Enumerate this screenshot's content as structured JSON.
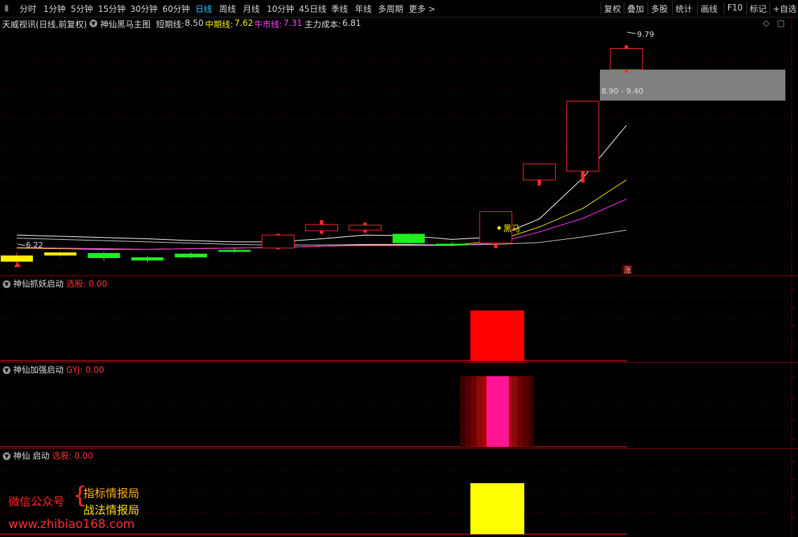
{
  "toolbar": {
    "periods": [
      "分时",
      "1分钟",
      "5分钟",
      "15分钟",
      "30分钟",
      "60分钟",
      "日线",
      "周线",
      "月线",
      "10分钟",
      "45日线",
      "季线",
      "年线",
      "多周期",
      "更多 >"
    ],
    "active_period": "日线",
    "right_buttons": [
      "复权",
      "叠加",
      "多股",
      "统计",
      "画线",
      "F10",
      "标记",
      "+自选"
    ]
  },
  "legend": {
    "stock": "天威视讯(日线,前复权)",
    "indicator": "神仙黑马主图",
    "short_label": "短期线:",
    "short_value": "8.50",
    "mid_label": "中期线:",
    "mid_value": "7.62",
    "bull_label": "牛市线:",
    "bull_value": "7.31",
    "cost_label": "主力成本:",
    "cost_value": "6.81",
    "right_icons": [
      "diamond-icon",
      "expand-icon"
    ]
  },
  "main_chart": {
    "high_label": "9.79",
    "low_label": "6.22",
    "range_label": "8.90 - 9.40",
    "signal_label": "黑马",
    "rise_badge": "涨"
  },
  "panels": [
    {
      "title": "神仙抓妖启动",
      "field_label": "选股:",
      "field_value": "0.00",
      "field_color": "#ff3333"
    },
    {
      "title": "神仙加强启动",
      "field_label": "GYJ:",
      "field_value": "0.00",
      "field_color": "#ff3333"
    },
    {
      "title": "神仙 启动",
      "field_label": "选股:",
      "field_value": "0.00",
      "field_color": "#ff3333"
    }
  ],
  "watermark": {
    "prefix": "微信公众号",
    "line1": "指标情报局",
    "line2": "战法情报局",
    "url": "www.zhibiao168.com"
  },
  "colors": {
    "up": "#ff2a2a",
    "down": "#22ee22",
    "flat": "#ffee00",
    "short_line": "#ffffff",
    "mid_line": "#ffee00",
    "bull_line": "#ff33ff",
    "cost_line": "#cccccc",
    "active_period": "#2fc4ff"
  },
  "chart_data": {
    "type": "candlestick",
    "candles": [
      {
        "o": 6.3,
        "c": 6.4,
        "h": 6.45,
        "l": 6.22,
        "color": "flat"
      },
      {
        "o": 6.4,
        "c": 6.45,
        "h": 6.47,
        "l": 6.38,
        "color": "flat"
      },
      {
        "o": 6.44,
        "c": 6.36,
        "h": 6.46,
        "l": 6.32,
        "color": "down"
      },
      {
        "o": 6.37,
        "c": 6.32,
        "h": 6.39,
        "l": 6.28,
        "color": "down"
      },
      {
        "o": 6.43,
        "c": 6.37,
        "h": 6.45,
        "l": 6.35,
        "color": "down"
      },
      {
        "o": 6.49,
        "c": 6.46,
        "h": 6.51,
        "l": 6.44,
        "color": "down"
      },
      {
        "o": 6.52,
        "c": 6.73,
        "h": 6.75,
        "l": 6.5,
        "color": "up"
      },
      {
        "o": 6.8,
        "c": 6.9,
        "h": 6.97,
        "l": 6.75,
        "color": "up"
      },
      {
        "o": 6.81,
        "c": 6.89,
        "h": 6.93,
        "l": 6.77,
        "color": "up"
      },
      {
        "o": 6.75,
        "c": 6.6,
        "h": 6.76,
        "l": 6.6,
        "color": "down"
      },
      {
        "o": 6.59,
        "c": 6.57,
        "h": 6.62,
        "l": 6.56,
        "color": "down"
      },
      {
        "o": 6.6,
        "c": 7.11,
        "h": 7.11,
        "l": 6.52,
        "color": "up"
      },
      {
        "o": 7.62,
        "c": 7.88,
        "h": 7.88,
        "l": 7.53,
        "color": "up"
      },
      {
        "o": 7.76,
        "c": 8.89,
        "h": 8.89,
        "l": 7.58,
        "color": "up"
      },
      {
        "o": 9.4,
        "c": 9.74,
        "h": 9.79,
        "l": 9.35,
        "color": "up"
      }
    ],
    "series": [
      {
        "name": "短期线",
        "color": "short_line",
        "values": [
          6.73,
          6.71,
          6.69,
          6.67,
          6.64,
          6.62,
          6.62,
          6.67,
          6.73,
          6.72,
          6.66,
          6.7,
          6.99,
          7.65,
          8.5
        ]
      },
      {
        "name": "中期线",
        "color": "mid_line",
        "values": [
          6.52,
          6.51,
          6.5,
          6.5,
          6.51,
          6.52,
          6.53,
          6.55,
          6.57,
          6.57,
          6.57,
          6.63,
          6.86,
          7.16,
          7.62
        ]
      },
      {
        "name": "牛市线",
        "color": "bull_line",
        "values": [
          6.53,
          6.52,
          6.51,
          6.5,
          6.51,
          6.52,
          6.53,
          6.55,
          6.56,
          6.56,
          6.56,
          6.6,
          6.78,
          7.0,
          7.31
        ]
      },
      {
        "name": "主力成本",
        "color": "cost_line",
        "values": [
          6.68,
          6.66,
          6.64,
          6.62,
          6.6,
          6.58,
          6.57,
          6.57,
          6.58,
          6.58,
          6.57,
          6.58,
          6.61,
          6.7,
          6.81
        ]
      }
    ],
    "ylim": [
      6.1,
      10.05
    ],
    "range_box": [
      8.9,
      9.4
    ],
    "panel_bars": [
      {
        "index": 11,
        "value": 1,
        "color": "#ff0000"
      },
      {
        "index": 11,
        "value": 1,
        "color": "#ff1493"
      },
      {
        "index": 11,
        "value": 1,
        "color": "#ffff00"
      }
    ]
  }
}
